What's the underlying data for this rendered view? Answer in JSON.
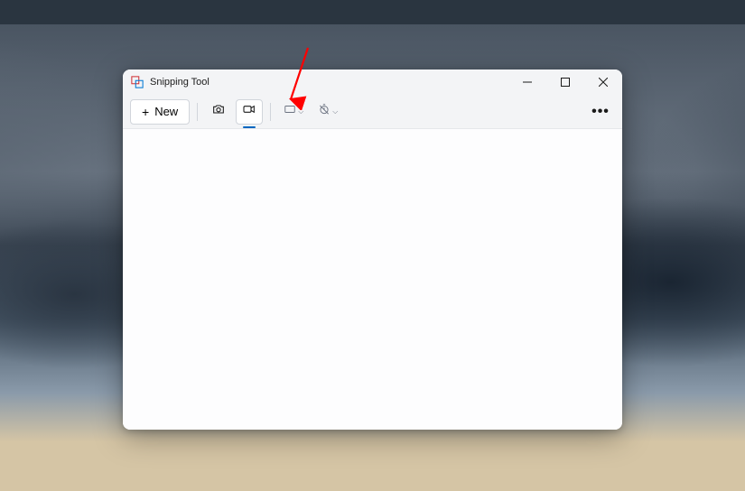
{
  "window": {
    "title": "Snipping Tool"
  },
  "toolbar": {
    "new_label": "New"
  },
  "annotation": {
    "arrow_color": "#ff0000"
  }
}
